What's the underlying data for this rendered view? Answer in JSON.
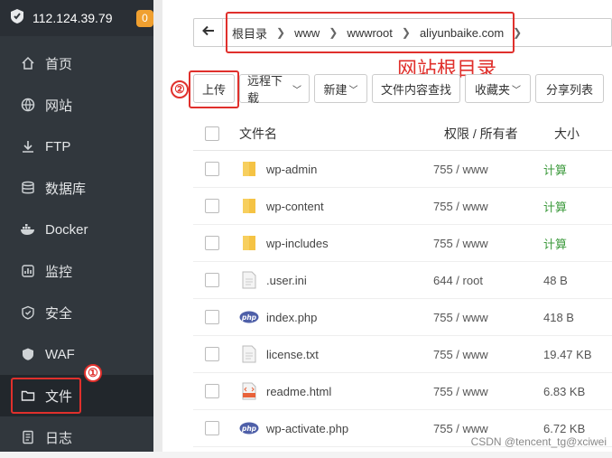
{
  "sidebar": {
    "server_ip": "112.124.39.79",
    "notification_count": "0",
    "items": [
      {
        "label": "首页",
        "icon": "home-icon"
      },
      {
        "label": "网站",
        "icon": "globe-icon"
      },
      {
        "label": "FTP",
        "icon": "ftp-icon"
      },
      {
        "label": "数据库",
        "icon": "database-icon"
      },
      {
        "label": "Docker",
        "icon": "docker-icon"
      },
      {
        "label": "监控",
        "icon": "monitor-icon"
      },
      {
        "label": "安全",
        "icon": "shield-icon"
      },
      {
        "label": "WAF",
        "icon": "waf-icon"
      },
      {
        "label": "文件",
        "icon": "folder-icon"
      },
      {
        "label": "日志",
        "icon": "log-icon"
      }
    ],
    "active": "文件"
  },
  "breadcrumb": {
    "items": [
      "根目录",
      "www",
      "wwwroot",
      "aliyunbaike.com"
    ]
  },
  "annotations": {
    "path_label": "网站根目录",
    "marker_1": "①",
    "marker_2": "②"
  },
  "toolbar": {
    "upload": "上传",
    "remote_download": "远程下载",
    "new": "新建",
    "search_content": "文件内容查找",
    "favorites": "收藏夹",
    "share_list": "分享列表"
  },
  "table": {
    "headers": {
      "name": "文件名",
      "perm": "权限 / 所有者",
      "size": "大小"
    },
    "rows": [
      {
        "name": "wp-admin",
        "type": "folder",
        "perm": "755 / www",
        "size": "计算"
      },
      {
        "name": "wp-content",
        "type": "folder",
        "perm": "755 / www",
        "size": "计算"
      },
      {
        "name": "wp-includes",
        "type": "folder",
        "perm": "755 / www",
        "size": "计算"
      },
      {
        "name": ".user.ini",
        "type": "file",
        "perm": "644 / root",
        "size": "48 B"
      },
      {
        "name": "index.php",
        "type": "php",
        "perm": "755 / www",
        "size": "418 B"
      },
      {
        "name": "license.txt",
        "type": "file",
        "perm": "755 / www",
        "size": "19.47 KB"
      },
      {
        "name": "readme.html",
        "type": "html",
        "perm": "755 / www",
        "size": "6.83 KB"
      },
      {
        "name": "wp-activate.php",
        "type": "php",
        "perm": "755 / www",
        "size": "6.72 KB"
      }
    ]
  },
  "watermark": "CSDN @tencent_tg@xciwei",
  "colors": {
    "sidebar_bg": "#31373d",
    "accent_red": "#e0302c",
    "calc_green": "#3c9a3c",
    "folder_yellow": "#f5c344"
  }
}
